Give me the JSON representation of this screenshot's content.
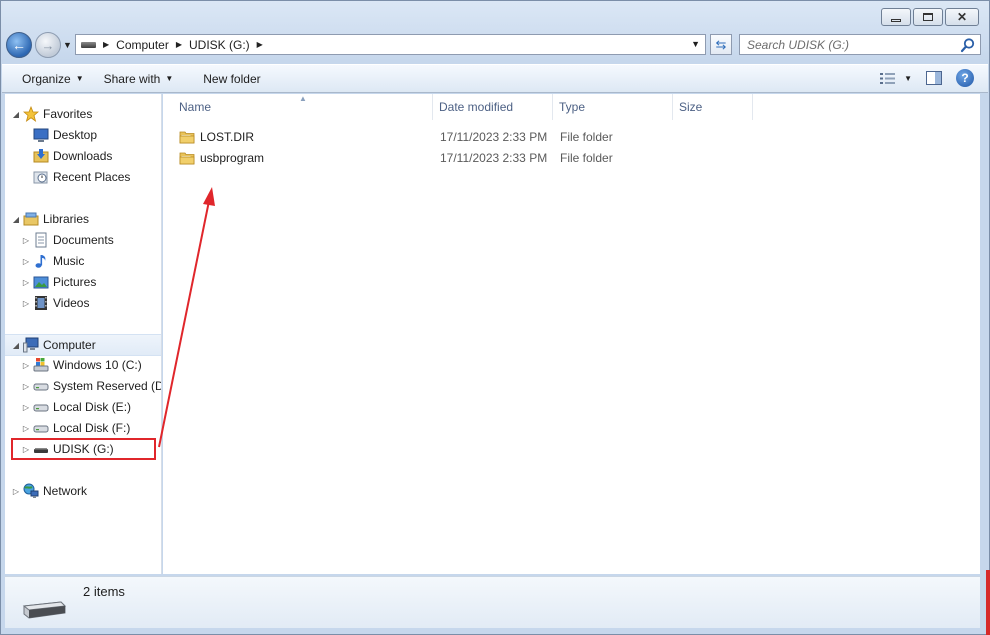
{
  "window": {
    "caption": {
      "minimize": "▭",
      "maximize": "⧉",
      "close": "✕"
    }
  },
  "address": {
    "crumbs": [
      "Computer",
      "UDISK (G:)"
    ]
  },
  "search": {
    "placeholder": "Search UDISK (G:)"
  },
  "toolbar": {
    "organize": "Organize",
    "share_with": "Share with",
    "new_folder": "New folder"
  },
  "nav": {
    "favorites": "Favorites",
    "desktop": "Desktop",
    "downloads": "Downloads",
    "recent_places": "Recent Places",
    "libraries": "Libraries",
    "documents": "Documents",
    "music": "Music",
    "pictures": "Pictures",
    "videos": "Videos",
    "computer": "Computer",
    "drive_c": "Windows 10 (C:)",
    "drive_d": "System Reserved (D:",
    "drive_e": "Local Disk (E:)",
    "drive_f": "Local Disk (F:)",
    "drive_g": "UDISK (G:)",
    "network": "Network"
  },
  "columns": {
    "name": "Name",
    "date_modified": "Date modified",
    "type": "Type",
    "size": "Size"
  },
  "files": [
    {
      "name": "LOST.DIR",
      "date": "17/11/2023 2:33 PM",
      "type": "File folder"
    },
    {
      "name": "usbprogram",
      "date": "17/11/2023 2:33 PM",
      "type": "File folder"
    }
  ],
  "status": {
    "count": "2 items"
  },
  "colors": {
    "annotation": "#e0262b",
    "accent": "#2d67b2"
  }
}
